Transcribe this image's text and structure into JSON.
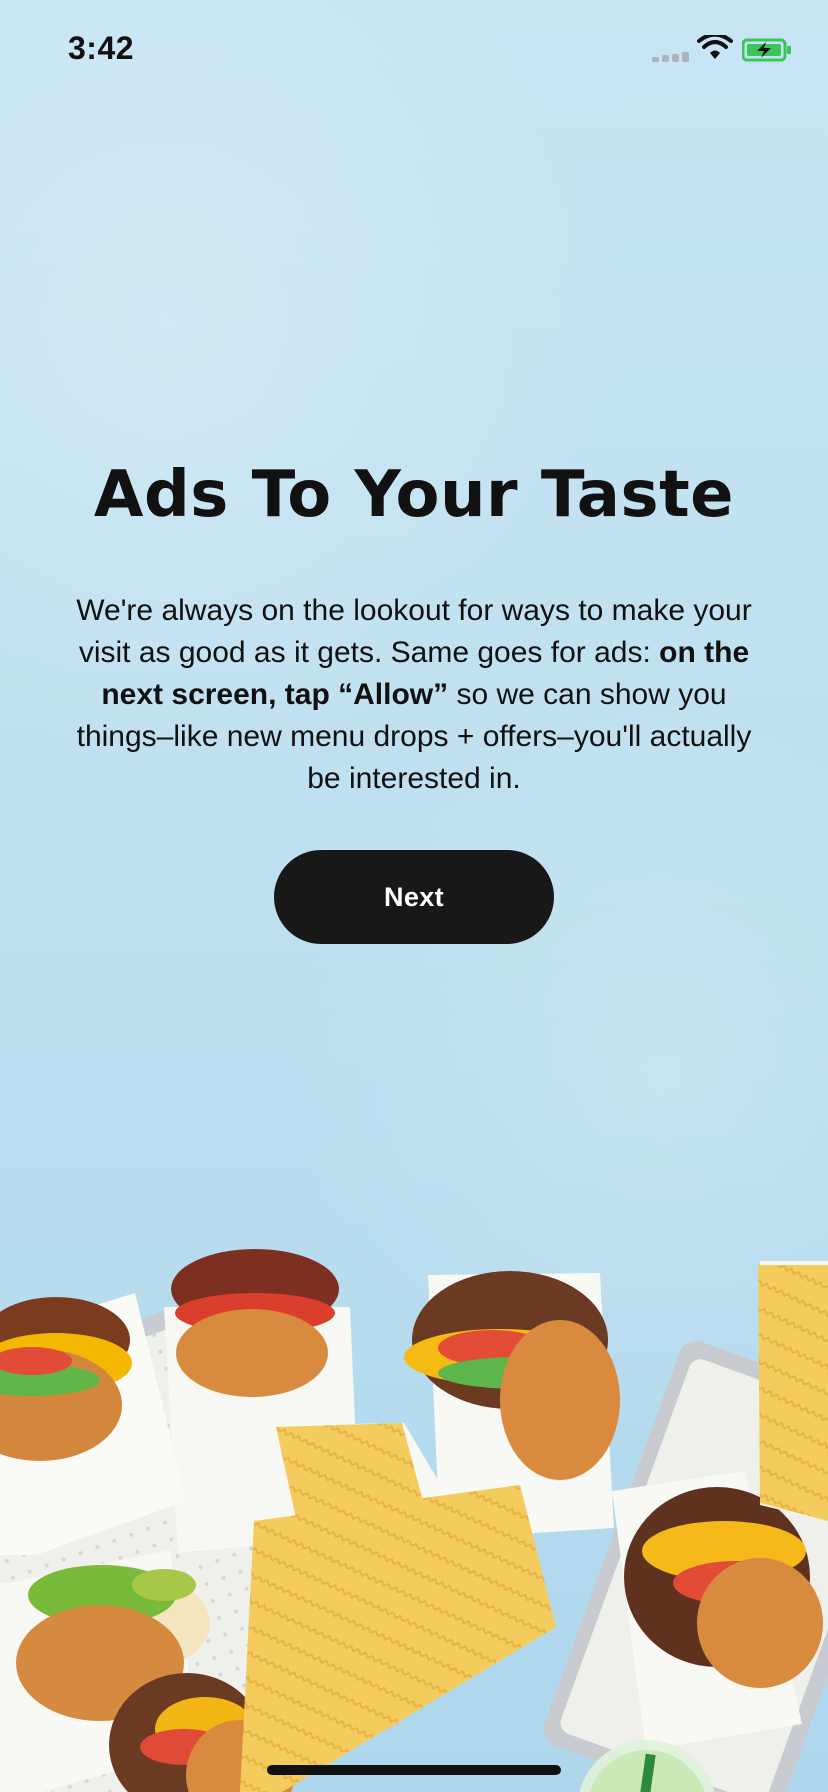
{
  "status_bar": {
    "time": "3:42"
  },
  "onboarding": {
    "title": "Ads To Your Taste",
    "body_intro": "We're always on the lookout for ways to make your visit as good as it gets. Same goes for ads: ",
    "body_bold": "on the next screen, tap “Allow”",
    "body_outro": " so we can show you things–like new menu drops + offers–you'll actually be interested in.",
    "next_label": "Next"
  },
  "colors": {
    "background": "#c3e1f0",
    "button": "#181818",
    "battery_fill": "#3cc65a"
  },
  "icons": {
    "signal": "cellular-signal-icon",
    "wifi": "wifi-icon",
    "battery": "battery-charging-icon"
  }
}
